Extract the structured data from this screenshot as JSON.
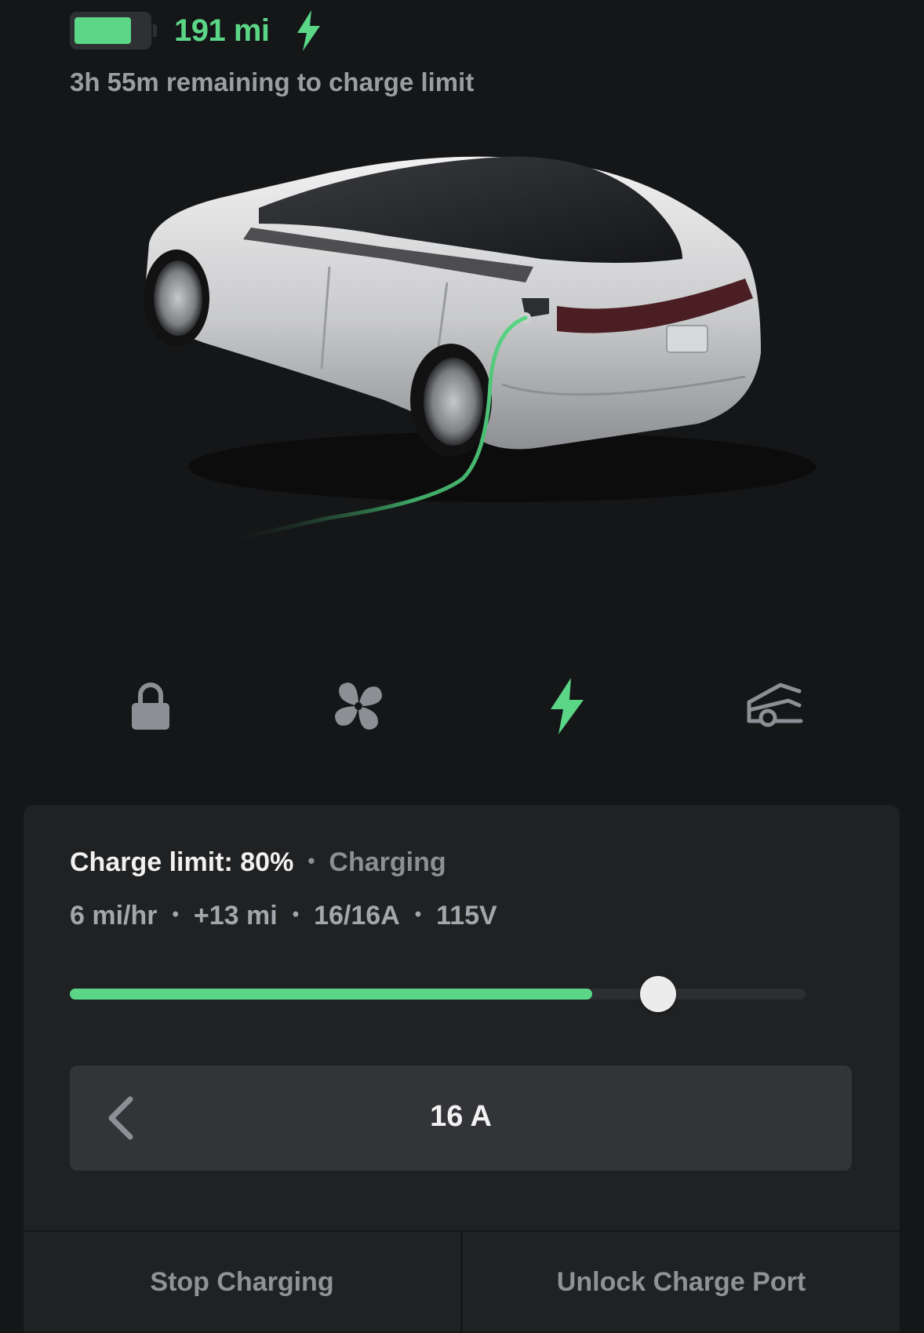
{
  "status": {
    "battery_level": 0.78,
    "range": "191 mi",
    "time_remaining": "3h 55m remaining to charge limit"
  },
  "quick_actions": [
    {
      "icon": "lock-icon",
      "active": false
    },
    {
      "icon": "fan-icon",
      "active": false
    },
    {
      "icon": "charge-bolt-icon",
      "active": true
    },
    {
      "icon": "frunk-icon",
      "active": false
    }
  ],
  "charge_panel": {
    "limit_text": "Charge limit: 80%",
    "state": "Charging",
    "stats": [
      "6 mi/hr",
      "+13 mi",
      "16/16A",
      "115V"
    ],
    "current_charge": 0.71,
    "charge_limit": 0.8,
    "amperage": "16 A",
    "stop_label": "Stop Charging",
    "unlock_label": "Unlock Charge Port"
  },
  "colors": {
    "accent": "#5bd686",
    "background": "#151618",
    "panel": "#202123",
    "icon_inactive": "#8c8f94"
  }
}
